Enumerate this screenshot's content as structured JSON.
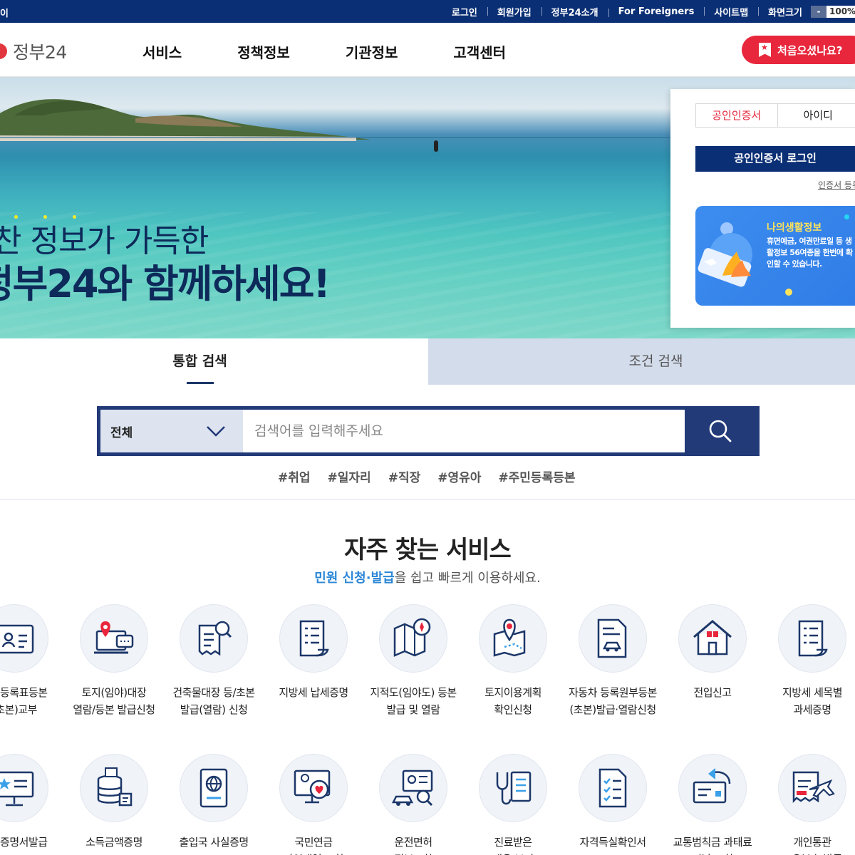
{
  "topbar": {
    "left_text": "이",
    "links": [
      "로그인",
      "회원가입",
      "정부24소개",
      "For Foreigners",
      "사이트맵"
    ],
    "fontsize": {
      "label": "화면크기",
      "minus": "-",
      "value": "100%"
    }
  },
  "header": {
    "logo": "정부24",
    "nav": [
      "서비스",
      "정책정보",
      "기관정보",
      "고객센터"
    ],
    "first_visit": "처음오셨나요?"
  },
  "hero": {
    "line1": "찬 정보가 가득한",
    "line2": "정부24와 함께하세요!"
  },
  "login": {
    "tabs": [
      "공인인증서",
      "아이디"
    ],
    "cert_button": "공인인증서 로그인",
    "cert_link": "인증서 등록",
    "life_card": {
      "title": "나의생활정보",
      "desc": "휴면예금, 여권만료일 등 생활정보 56여종을 한번에 확인할 수 있습니다."
    }
  },
  "search": {
    "tabs": [
      "통합 검색",
      "조건 검색"
    ],
    "select_value": "전체",
    "placeholder": "검색어를 입력해주세요",
    "hashtags": [
      "#취업",
      "#일자리",
      "#직장",
      "#영유아",
      "#주민등록등본"
    ]
  },
  "services": {
    "title": "자주 찾는 서비스",
    "subtitle_highlight": "민원 신청·발급",
    "subtitle_rest": "을 쉽고 빠르게 이용하세요.",
    "row1": [
      {
        "icon": "id-card-icon",
        "l1": "주민등록표등본",
        "l2": "(초본)교부"
      },
      {
        "icon": "laptop-location-icon",
        "l1": "토지(임야)대장",
        "l2": "열람/등본 발급신청"
      },
      {
        "icon": "document-search-icon",
        "l1": "건축물대장 등/초본",
        "l2": "발급(열람) 신청"
      },
      {
        "icon": "scroll-list-icon",
        "l1": "지방세 납세증명",
        "l2": ""
      },
      {
        "icon": "map-compass-icon",
        "l1": "지적도(임야도) 등본",
        "l2": "발급 및 열람"
      },
      {
        "icon": "map-pin-icon",
        "l1": "토지이용계획",
        "l2": "확인신청"
      },
      {
        "icon": "car-document-icon",
        "l1": "자동차 등록원부등본",
        "l2": "(초본)발급·열람신청"
      },
      {
        "icon": "house-icon",
        "l1": "전입신고",
        "l2": ""
      },
      {
        "icon": "tax-scroll-icon",
        "l1": "지방세 세목별",
        "l2": "과세증명"
      }
    ],
    "row2": [
      {
        "icon": "monitor-star-icon",
        "l1": "자격증명서발급",
        "l2": ""
      },
      {
        "icon": "database-icon",
        "l1": "소득금액증명",
        "l2": ""
      },
      {
        "icon": "passport-icon",
        "l1": "출입국 사실증명",
        "l2": ""
      },
      {
        "icon": "heart-monitor-icon",
        "l1": "국민연금",
        "l2": "가입내역 조회"
      },
      {
        "icon": "car-license-icon",
        "l1": "운전면허",
        "l2": "정보조회"
      },
      {
        "icon": "stethoscope-icon",
        "l1": "진료받은",
        "l2": "내용 보기"
      },
      {
        "icon": "checklist-icon",
        "l1": "자격득실확인서",
        "l2": ""
      },
      {
        "icon": "card-return-icon",
        "l1": "교통범칙금 과태료",
        "l2": "미납 조회"
      },
      {
        "icon": "plane-ticket-icon",
        "l1": "개인통관",
        "l2": "고유부호 발급"
      }
    ]
  }
}
